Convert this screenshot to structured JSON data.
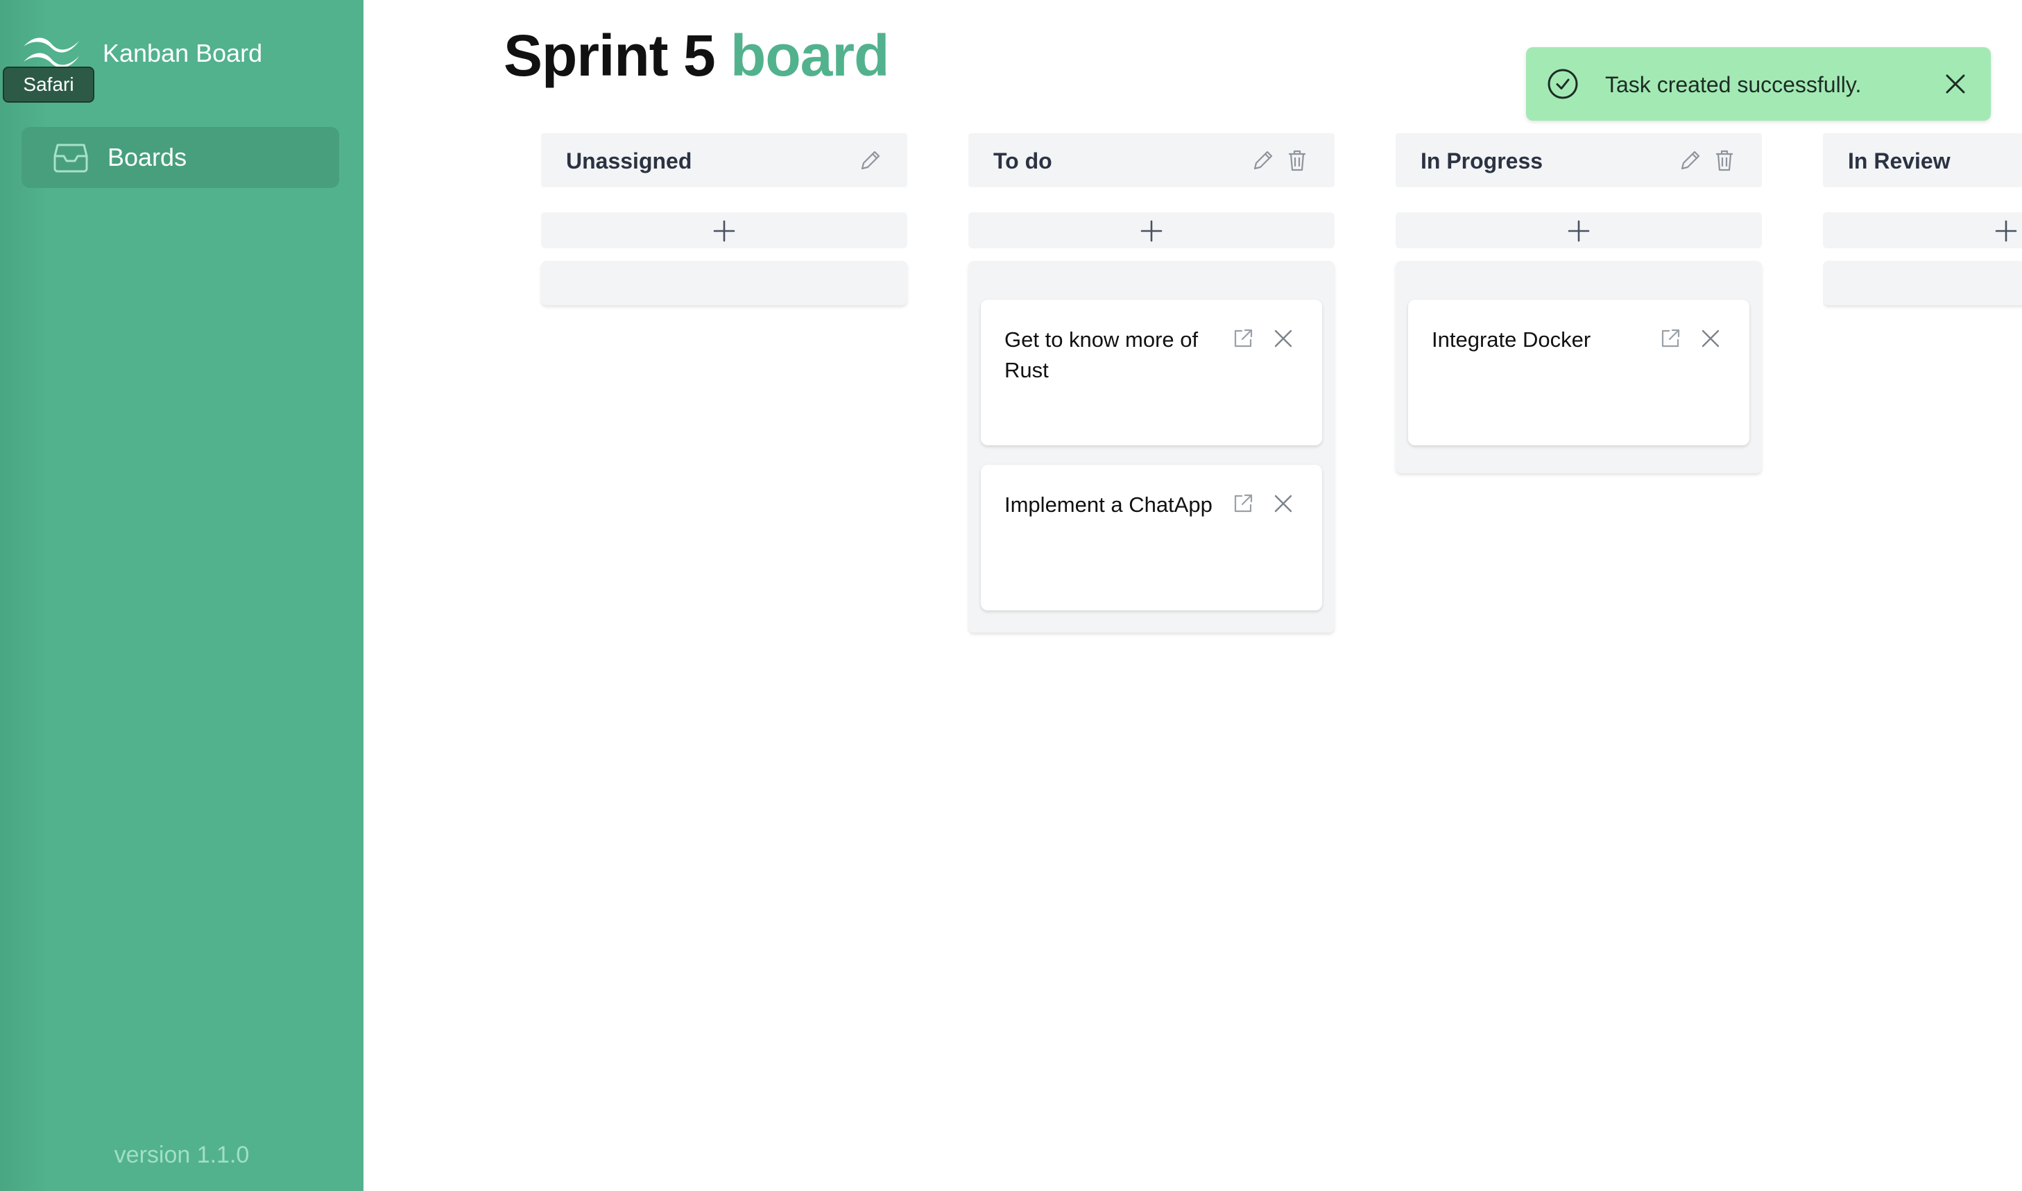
{
  "sidebar": {
    "app_title": "Kanban Board",
    "tooltip": "Safari",
    "nav": [
      {
        "label": "Boards",
        "icon": "inbox-tray-icon"
      }
    ],
    "version": "version 1.1.0"
  },
  "header": {
    "title_main": "Sprint 5",
    "title_accent": "board"
  },
  "toast": {
    "message": "Task created successfully.",
    "icon": "check-circle-icon"
  },
  "columns": [
    {
      "title": "Unassigned",
      "cards": []
    },
    {
      "title": "To do",
      "cards": [
        {
          "title": "Get to know more of Rust"
        },
        {
          "title": "Implement a ChatApp"
        }
      ]
    },
    {
      "title": "In Progress",
      "cards": [
        {
          "title": "Integrate Docker"
        }
      ]
    },
    {
      "title": "In Review",
      "cards": []
    }
  ],
  "colors": {
    "sidebar": "#52b28e",
    "accent": "#52b28e",
    "toast": "#a3e9b4",
    "column": "#f3f4f6"
  }
}
